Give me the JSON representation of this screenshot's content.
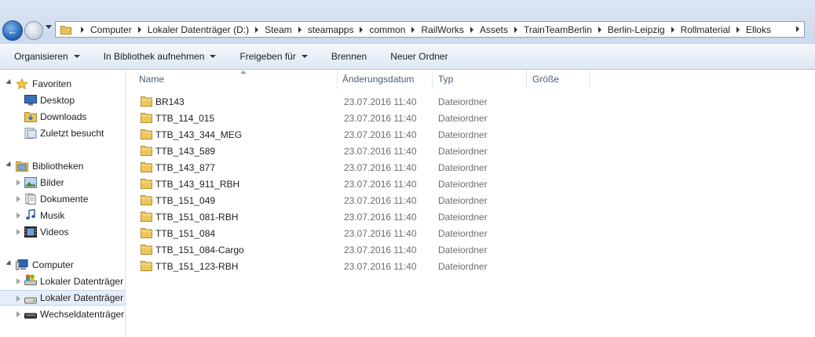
{
  "breadcrumbs": [
    "Computer",
    "Lokaler Datenträger (D:)",
    "Steam",
    "steamapps",
    "common",
    "RailWorks",
    "Assets",
    "TrainTeamBerlin",
    "Berlin-Leipzig",
    "Rollmaterial",
    "Elloks"
  ],
  "toolbar": {
    "organize": "Organisieren",
    "library": "In Bibliothek aufnehmen",
    "share": "Freigeben für",
    "burn": "Brennen",
    "new_folder": "Neuer Ordner"
  },
  "nav": {
    "favorites": "Favoriten",
    "desktop": "Desktop",
    "downloads": "Downloads",
    "recent": "Zuletzt besucht",
    "libraries": "Bibliotheken",
    "pictures": "Bilder",
    "documents": "Dokumente",
    "music": "Musik",
    "videos": "Videos",
    "computer": "Computer",
    "drive1": "Lokaler Datenträger",
    "drive2": "Lokaler Datenträger",
    "removable": "Wechseldatenträger"
  },
  "columns": {
    "name": "Name",
    "date": "Änderungsdatum",
    "type": "Typ",
    "size": "Größe"
  },
  "files": [
    {
      "name": "BR143",
      "date": "23.07.2016 11:40",
      "type": "Dateiordner"
    },
    {
      "name": "TTB_114_015",
      "date": "23.07.2016 11:40",
      "type": "Dateiordner"
    },
    {
      "name": "TTB_143_344_MEG",
      "date": "23.07.2016 11:40",
      "type": "Dateiordner"
    },
    {
      "name": "TTB_143_589",
      "date": "23.07.2016 11:40",
      "type": "Dateiordner"
    },
    {
      "name": "TTB_143_877",
      "date": "23.07.2016 11:40",
      "type": "Dateiordner"
    },
    {
      "name": "TTB_143_911_RBH",
      "date": "23.07.2016 11:40",
      "type": "Dateiordner"
    },
    {
      "name": "TTB_151_049",
      "date": "23.07.2016 11:40",
      "type": "Dateiordner"
    },
    {
      "name": "TTB_151_081-RBH",
      "date": "23.07.2016 11:40",
      "type": "Dateiordner"
    },
    {
      "name": "TTB_151_084",
      "date": "23.07.2016 11:40",
      "type": "Dateiordner"
    },
    {
      "name": "TTB_151_084-Cargo",
      "date": "23.07.2016 11:40",
      "type": "Dateiordner"
    },
    {
      "name": "TTB_151_123-RBH",
      "date": "23.07.2016 11:40",
      "type": "Dateiordner"
    }
  ]
}
